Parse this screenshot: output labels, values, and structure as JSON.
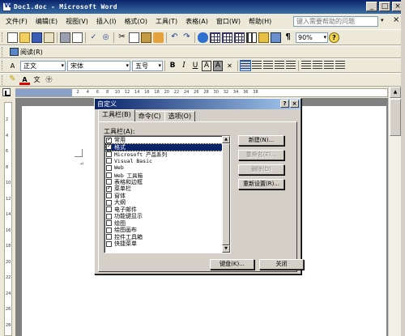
{
  "window": {
    "title": "Doc1.doc - Microsoft Word",
    "controls": [
      "_",
      "□",
      "×"
    ]
  },
  "menu": {
    "items": [
      "文件(F)",
      "编辑(E)",
      "视图(V)",
      "插入(I)",
      "格式(O)",
      "工具(T)",
      "表格(A)",
      "窗口(W)",
      "帮助(H)"
    ],
    "help_placeholder": "键入需要帮助的问题",
    "close_glyph": "×"
  },
  "standard_toolbar": {
    "zoom": "90%"
  },
  "reading_toolbar": {
    "read_label": "阅读(R)"
  },
  "formatting_toolbar": {
    "style": "正文",
    "font": "宋体",
    "size": "五号",
    "bold": "B",
    "italic": "I",
    "underline": "U",
    "char_border": "A",
    "char_shading": "A"
  },
  "drawing_toolbar": {
    "font_color": "A"
  },
  "ruler": {
    "numbers": [
      "2",
      "4",
      "6",
      "8",
      "10",
      "12",
      "14",
      "16",
      "18",
      "20",
      "22",
      "24",
      "26",
      "28",
      "30",
      "32",
      "34",
      "36",
      "38"
    ]
  },
  "vruler": {
    "numbers": [
      "2",
      "4",
      "6",
      "8",
      "10",
      "12",
      "14",
      "16",
      "18",
      "20",
      "22",
      "24",
      "26",
      "28"
    ]
  },
  "dialog": {
    "title": "自定义",
    "title_buttons": [
      "?",
      "×"
    ],
    "tabs": [
      "工具栏(B)",
      "命令(C)",
      "选项(O)"
    ],
    "list_label": "工具栏(A):",
    "toolbars": [
      {
        "label": "常用",
        "checked": true,
        "selected": false,
        "mono": false
      },
      {
        "label": "格式",
        "checked": true,
        "selected": true,
        "mono": false
      },
      {
        "label": "Microsoft 产品系列",
        "checked": false,
        "selected": false,
        "mono": true
      },
      {
        "label": "Visual Basic",
        "checked": false,
        "selected": false,
        "mono": true
      },
      {
        "label": "Web",
        "checked": false,
        "selected": false,
        "mono": true
      },
      {
        "label": "Web 工具箱",
        "checked": false,
        "selected": false,
        "mono": true
      },
      {
        "label": "表格和边框",
        "checked": false,
        "selected": false,
        "mono": false
      },
      {
        "label": "菜单栏",
        "checked": true,
        "selected": false,
        "mono": false
      },
      {
        "label": "窗体",
        "checked": false,
        "selected": false,
        "mono": false
      },
      {
        "label": "大纲",
        "checked": false,
        "selected": false,
        "mono": false
      },
      {
        "label": "电子邮件",
        "checked": false,
        "selected": false,
        "mono": false
      },
      {
        "label": "功能键显示",
        "checked": false,
        "selected": false,
        "mono": false
      },
      {
        "label": "绘图",
        "checked": false,
        "selected": false,
        "mono": false
      },
      {
        "label": "绘图画布",
        "checked": false,
        "selected": false,
        "mono": false
      },
      {
        "label": "控件工具箱",
        "checked": false,
        "selected": false,
        "mono": false
      },
      {
        "label": "快捷菜单",
        "checked": false,
        "selected": false,
        "mono": false
      }
    ],
    "buttons": {
      "new": "新建(N)...",
      "rename": "重命名(E)...",
      "delete": "删除(D)",
      "reset": "重新设置(R)...",
      "keyboard": "键盘(K)...",
      "close": "关闭"
    }
  }
}
